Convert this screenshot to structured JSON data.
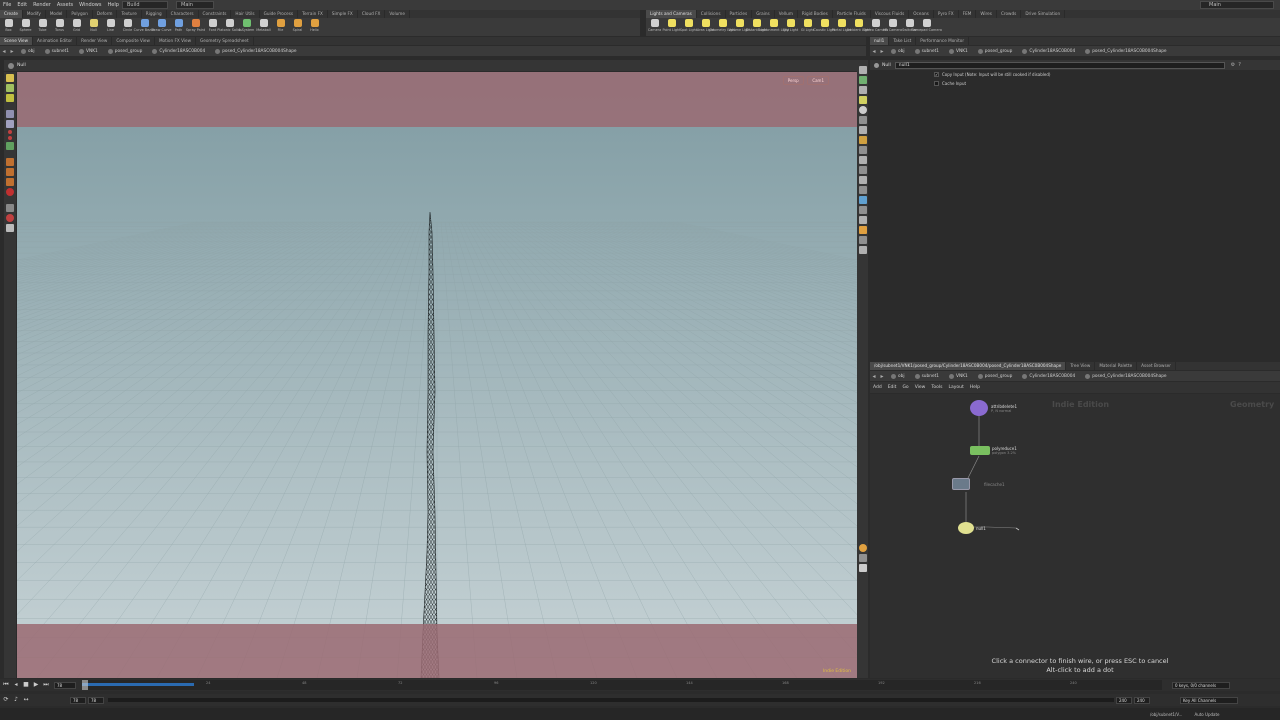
{
  "menu": [
    "File",
    "Edit",
    "Render",
    "Assets",
    "Windows",
    "Help"
  ],
  "desktop": "Build",
  "main_left": "Main",
  "main_right": "Main",
  "shelf_tabs_left": [
    {
      "label": "Create",
      "active": true
    },
    {
      "label": "Modify"
    },
    {
      "label": "Model"
    },
    {
      "label": "Polygon"
    },
    {
      "label": "Deform"
    },
    {
      "label": "Texture"
    },
    {
      "label": "Rigging"
    },
    {
      "label": "Characters"
    },
    {
      "label": "Constraints"
    },
    {
      "label": "Hair Utils"
    },
    {
      "label": "Guide Process"
    },
    {
      "label": "Terrain FX"
    },
    {
      "label": "Simple FX"
    },
    {
      "label": "Cloud FX"
    },
    {
      "label": "Volume"
    }
  ],
  "shelf_tools_left": [
    {
      "label": "Box",
      "color": "#d0d0d0"
    },
    {
      "label": "Sphere",
      "color": "#d0d0d0"
    },
    {
      "label": "Tube",
      "color": "#d0d0d0"
    },
    {
      "label": "Torus",
      "color": "#d0d0d0"
    },
    {
      "label": "Grid",
      "color": "#d0d0d0"
    },
    {
      "label": "Null",
      "color": "#e0d070"
    },
    {
      "label": "Line",
      "color": "#d0d0d0"
    },
    {
      "label": "Circle",
      "color": "#d0d0d0"
    },
    {
      "label": "Curve Bezier",
      "color": "#70a0e0"
    },
    {
      "label": "Draw Curve",
      "color": "#70a0e0"
    },
    {
      "label": "Path",
      "color": "#70a0e0"
    },
    {
      "label": "Spray Paint",
      "color": "#e08040"
    },
    {
      "label": "Font",
      "color": "#d0d0d0"
    },
    {
      "label": "Platonic Solids",
      "color": "#d0d0d0"
    },
    {
      "label": "L-System",
      "color": "#70c070"
    },
    {
      "label": "Metaball",
      "color": "#d0d0d0"
    },
    {
      "label": "File",
      "color": "#e0a040"
    },
    {
      "label": "Spiral",
      "color": "#e0a040"
    },
    {
      "label": "Helix",
      "color": "#e0a040"
    }
  ],
  "shelf_tabs_right": [
    {
      "label": "Lights and Cameras",
      "active": true
    },
    {
      "label": "Collisions"
    },
    {
      "label": "Particles"
    },
    {
      "label": "Grains"
    },
    {
      "label": "Vellum"
    },
    {
      "label": "Rigid Bodies"
    },
    {
      "label": "Particle Fluids"
    },
    {
      "label": "Viscous Fluids"
    },
    {
      "label": "Oceans"
    },
    {
      "label": "Pyro FX"
    },
    {
      "label": "FEM"
    },
    {
      "label": "Wires"
    },
    {
      "label": "Crowds"
    },
    {
      "label": "Drive Simulation"
    }
  ],
  "shelf_tools_right": [
    {
      "label": "Camera",
      "color": "#d0d0d0"
    },
    {
      "label": "Point Light",
      "color": "#f0e060"
    },
    {
      "label": "Spot Light",
      "color": "#f0e060"
    },
    {
      "label": "Area Light",
      "color": "#f0e060"
    },
    {
      "label": "Geometry Light",
      "color": "#f0e060"
    },
    {
      "label": "Volume Light",
      "color": "#f0e060"
    },
    {
      "label": "Distant Light",
      "color": "#f0e060"
    },
    {
      "label": "Environment Light",
      "color": "#f0e060"
    },
    {
      "label": "Sky Light",
      "color": "#f0e060"
    },
    {
      "label": "GI Light",
      "color": "#f0e060"
    },
    {
      "label": "Caustic Light",
      "color": "#f0e060"
    },
    {
      "label": "Portal Light",
      "color": "#f0e060"
    },
    {
      "label": "Ambient Light",
      "color": "#f0e060"
    },
    {
      "label": "Stereo Camera",
      "color": "#d0d0d0"
    },
    {
      "label": "VR Camera",
      "color": "#d0d0d0"
    },
    {
      "label": "Switcher",
      "color": "#d0d0d0"
    },
    {
      "label": "Gamepad Camera",
      "color": "#d0d0d0"
    }
  ],
  "pane_tabs_left": [
    {
      "label": "Scene View",
      "active": true
    },
    {
      "label": "Animation Editor"
    },
    {
      "label": "Render View"
    },
    {
      "label": "Composite View"
    },
    {
      "label": "Motion FX View"
    },
    {
      "label": "Geometry Spreadsheet"
    }
  ],
  "pane_tabs_right": [
    {
      "label": "null1",
      "active": true
    },
    {
      "label": "Take List"
    },
    {
      "label": "Performance Monitor"
    }
  ],
  "path_left": [
    "obj",
    "subnet1",
    "VNK1",
    "posed_group",
    "Cylinder18ASC0B004",
    "posed_Cylinder18ASC0B004Shape"
  ],
  "path_right": [
    "obj",
    "subnet1",
    "VNK1",
    "posed_group",
    "Cylinder18ASC0B004",
    "posed_Cylinder18ASC0B004Shape"
  ],
  "viewport": {
    "title": "Null",
    "persp": "Persp",
    "cam": "Cam1",
    "watermark": "Indie Edition",
    "bg_top": "#7f9ba2",
    "bg_bottom": "#c7d3d6",
    "safe_zone": "#9a6a72"
  },
  "params": {
    "node_type": "Null",
    "node_name": "null1",
    "copy_input_label": "Copy Input (Note: Input will be still cooked if disabled)",
    "copy_input_checked": true,
    "cache_input_label": "Cache Input",
    "cache_input_checked": false
  },
  "net_tabs": [
    {
      "label": "/obj/subnet1/VNK1/posed_group/Cylinder18ASC0B004/posed_Cylinder18ASC0B004Shape",
      "active": true
    },
    {
      "label": "Tree View"
    },
    {
      "label": "Material Palette"
    },
    {
      "label": "Asset Browser"
    }
  ],
  "net_menu": [
    "Add",
    "Edit",
    "Go",
    "View",
    "Tools",
    "Layout",
    "Help"
  ],
  "network": {
    "watermark_indie": "Indie Edition",
    "watermark_context": "Geometry",
    "nodes": [
      {
        "name": "attribdelete1",
        "sub": "P, N\nnormal",
        "color": "#8a6ad0"
      },
      {
        "name": "polyreduce1",
        "sub": "polygon\n3.2%",
        "color": "#7ac060"
      },
      {
        "name": "filecache1",
        "sub": "",
        "color": "#6a7a8a"
      },
      {
        "name": "null1",
        "sub": "",
        "color": "#e0e090"
      }
    ],
    "message_line1": "Click a connector to finish wire, or press ESC to cancel",
    "message_line2": "Alt-click to add a dot"
  },
  "timeline": {
    "current_frame": "78",
    "start_frame": "78",
    "end_frame": "78",
    "range_start": "1",
    "range_end": "240",
    "range_end2": "240",
    "ticks": [
      "24",
      "48",
      "72",
      "96",
      "120",
      "144",
      "168",
      "192",
      "216",
      "240"
    ],
    "keys_label": "0 keys, 0/0 channels",
    "key_all": "Key All Channels",
    "auto_update": "Auto Update",
    "status_path": "/obj/subnet1/V..."
  }
}
